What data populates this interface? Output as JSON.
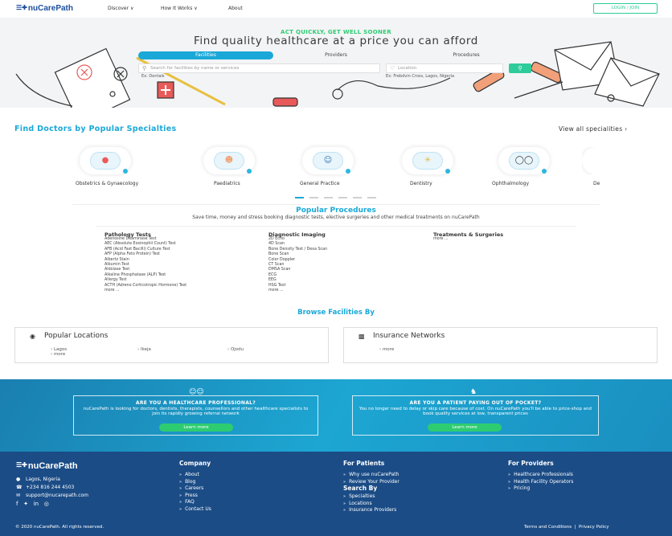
{
  "brand": {
    "name": "nuCarePath",
    "mark": "☰✚",
    "copyright_brand": "nuCarePath"
  },
  "header": {
    "nav": [
      "Discover ∨",
      "How It Works ∨",
      "About"
    ],
    "login_label": "LOGIN / JOIN"
  },
  "hero": {
    "tagline": "ACT QUICKLY, GET WELL SOONER",
    "headline": "Find quality healthcare at a price you can afford",
    "tabs": [
      "Facilities",
      "Providers",
      "Procedures"
    ],
    "search_placeholder": "Search for facilities by name or services",
    "location_placeholder": "Location",
    "search_hint": "Ex: Dentals",
    "location_hint": "Ex: Frebdvin Cross, Lagos, Nigeria"
  },
  "specialities": {
    "title": "Find Doctors by Popular Specialties",
    "view_all": "View all specialities ›",
    "items": [
      {
        "label": "Obstetrics & Gynaecology",
        "icon": "pregnancy-icon"
      },
      {
        "label": "Paediatrics",
        "icon": "baby-icon"
      },
      {
        "label": "General Practice",
        "icon": "stethoscope-icon"
      },
      {
        "label": "Dentistry",
        "icon": "tooth-icon"
      },
      {
        "label": "Ophthalmology",
        "icon": "glasses-icon"
      },
      {
        "label": "De",
        "icon": "derm-icon"
      }
    ]
  },
  "procedures": {
    "title": "Popular Procedures",
    "subtitle": "Save time, money and stress booking diagnostic tests, elective surgeries and other medical treatments on nuCarePath",
    "columns": [
      {
        "heading": "Pathology Tests",
        "items": [
          "Adenosine Deaminase Test",
          "AEC (Absolute Eosinophil Count) Test",
          "AFB (Acid Fast Bacilli) Culture Test",
          "AFP (Alpha Feto Protein) Test",
          "Albertz Stain",
          "Albumin Test",
          "Aldolase Test",
          "Alkaline Phosphatase (ALP) Test",
          "Allergy Test",
          "ACTH (Adreno Corticotropic Hormone) Test",
          "more ..."
        ]
      },
      {
        "heading": "Diagnostic Imaging",
        "items": [
          "2D Echo",
          "4D Scan",
          "Bone Density Test / Dexa Scan",
          "Bone Scan",
          "Color Doppler",
          "CT Scan",
          "DMSA Scan",
          "ECG",
          "EEG",
          "HSG Test",
          "more ..."
        ]
      },
      {
        "heading": "Treatments & Surgeries",
        "items": [
          "more ..."
        ]
      }
    ]
  },
  "facilities": {
    "title": "Browse Facilities By",
    "locations": {
      "heading": "Popular Locations",
      "links": [
        "Lagos",
        "Ikeja",
        "Ojodu",
        "more"
      ]
    },
    "insurance": {
      "heading": "Insurance Networks",
      "links": [
        "more"
      ]
    }
  },
  "cta": {
    "professional": {
      "title": "ARE YOU A HEALTHCARE PROFESSIONAL?",
      "text": "nuCarePath is looking for doctors, dentists, therapists, counsellors and other healthcare specialists to join its rapidly growing referral network",
      "button": "Learn more"
    },
    "patient": {
      "title": "ARE YOU A PATIENT PAYING OUT OF POCKET?",
      "text": "You no longer need to delay or skip care because of cost. On nuCarePath you'll be able to price-shop and book quality services at low, transparent prices",
      "button": "Learn more"
    }
  },
  "footer": {
    "contact": {
      "address": "Lagos, Nigeria",
      "phone": "+234 816 244 4503",
      "email": "support@nucarepath.com"
    },
    "company": {
      "heading": "Company",
      "links": [
        "About",
        "Blog",
        "Careers",
        "Press",
        "FAQ",
        "Contact Us"
      ]
    },
    "patients": {
      "heading": "For Patients",
      "links": [
        "Why use nuCarePath",
        "Review Your Provider"
      ]
    },
    "search_by": {
      "heading": "Search By",
      "links": [
        "Specialties",
        "Locations",
        "Insurance Providers"
      ]
    },
    "providers": {
      "heading": "For Providers",
      "links": [
        "Healthcare Professionals",
        "Health Facility Operators",
        "Pricing"
      ]
    },
    "copyright": "© 2020 nuCarePath. All rights reserved.",
    "terms": "Terms and Conditions",
    "privacy": "Privacy Policy",
    "separator": "|"
  },
  "colors": {
    "accent": "#1aa8d8",
    "green": "#2ecc71",
    "footer": "#1b4c86"
  }
}
